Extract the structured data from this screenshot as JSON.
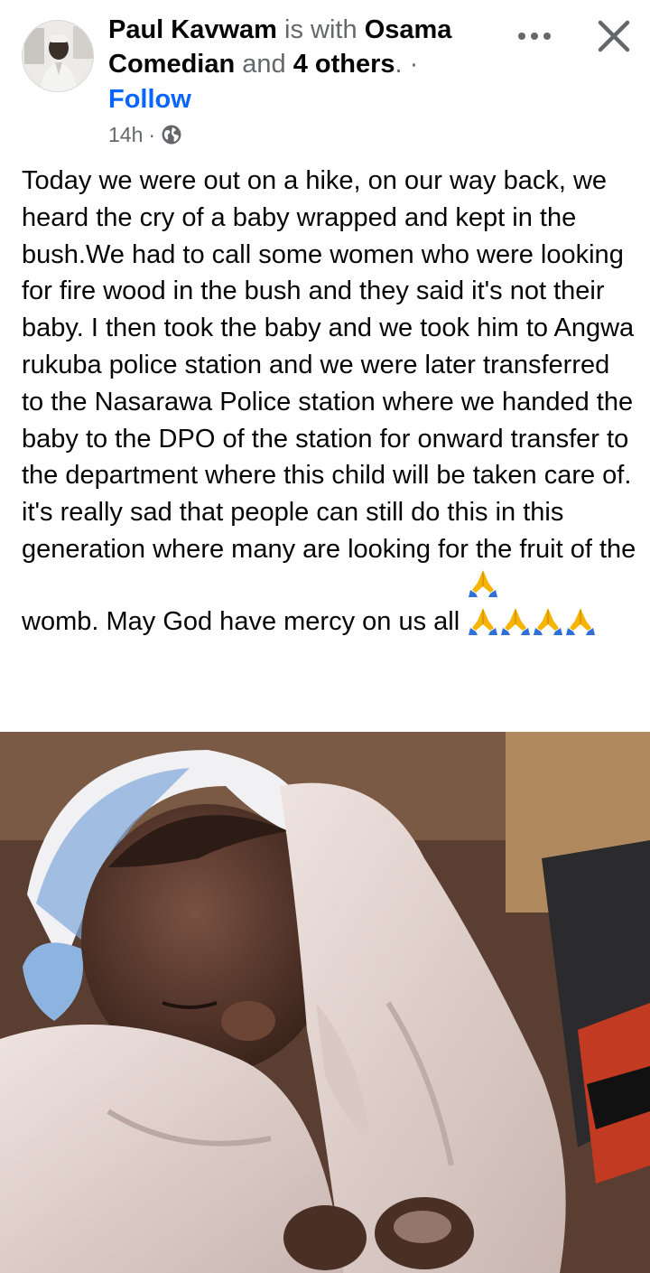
{
  "post": {
    "author": "Paul Kavwam",
    "with_text": "is with",
    "tagged": "Osama Comedian",
    "and_text": "and",
    "others": "4 others",
    "tail": ".",
    "separator": "·",
    "follow_label": "Follow",
    "time": "14h",
    "time_separator": "·",
    "privacy_icon": "globe-icon",
    "body": "Today we were out on a hike, on our way back, we heard the cry of a baby wrapped and kept in the bush.We had to call some women who were looking for fire wood in the bush and they said it's not their baby. I then took the baby and we took him to Angwa rukuba police station and we were later transferred to the Nasarawa Police station where we handed the baby to the DPO of the station for onward transfer to the department where this child will be taken care of.\nit's really sad that people can still do this in this generation where many are looking for the fruit of the womb. May God have mercy on us all ",
    "emoji": [
      "folded-hands",
      "folded-hands",
      "folded-hands",
      "folded-hands",
      "folded-hands"
    ],
    "photo": "photo-newborn-baby-in-blanket"
  },
  "colors": {
    "link": "#0866ff",
    "secondary_text": "#65676b",
    "primary_text": "#050505",
    "emoji_yellow": "#f6b400",
    "emoji_blue": "#2f6fd6"
  }
}
